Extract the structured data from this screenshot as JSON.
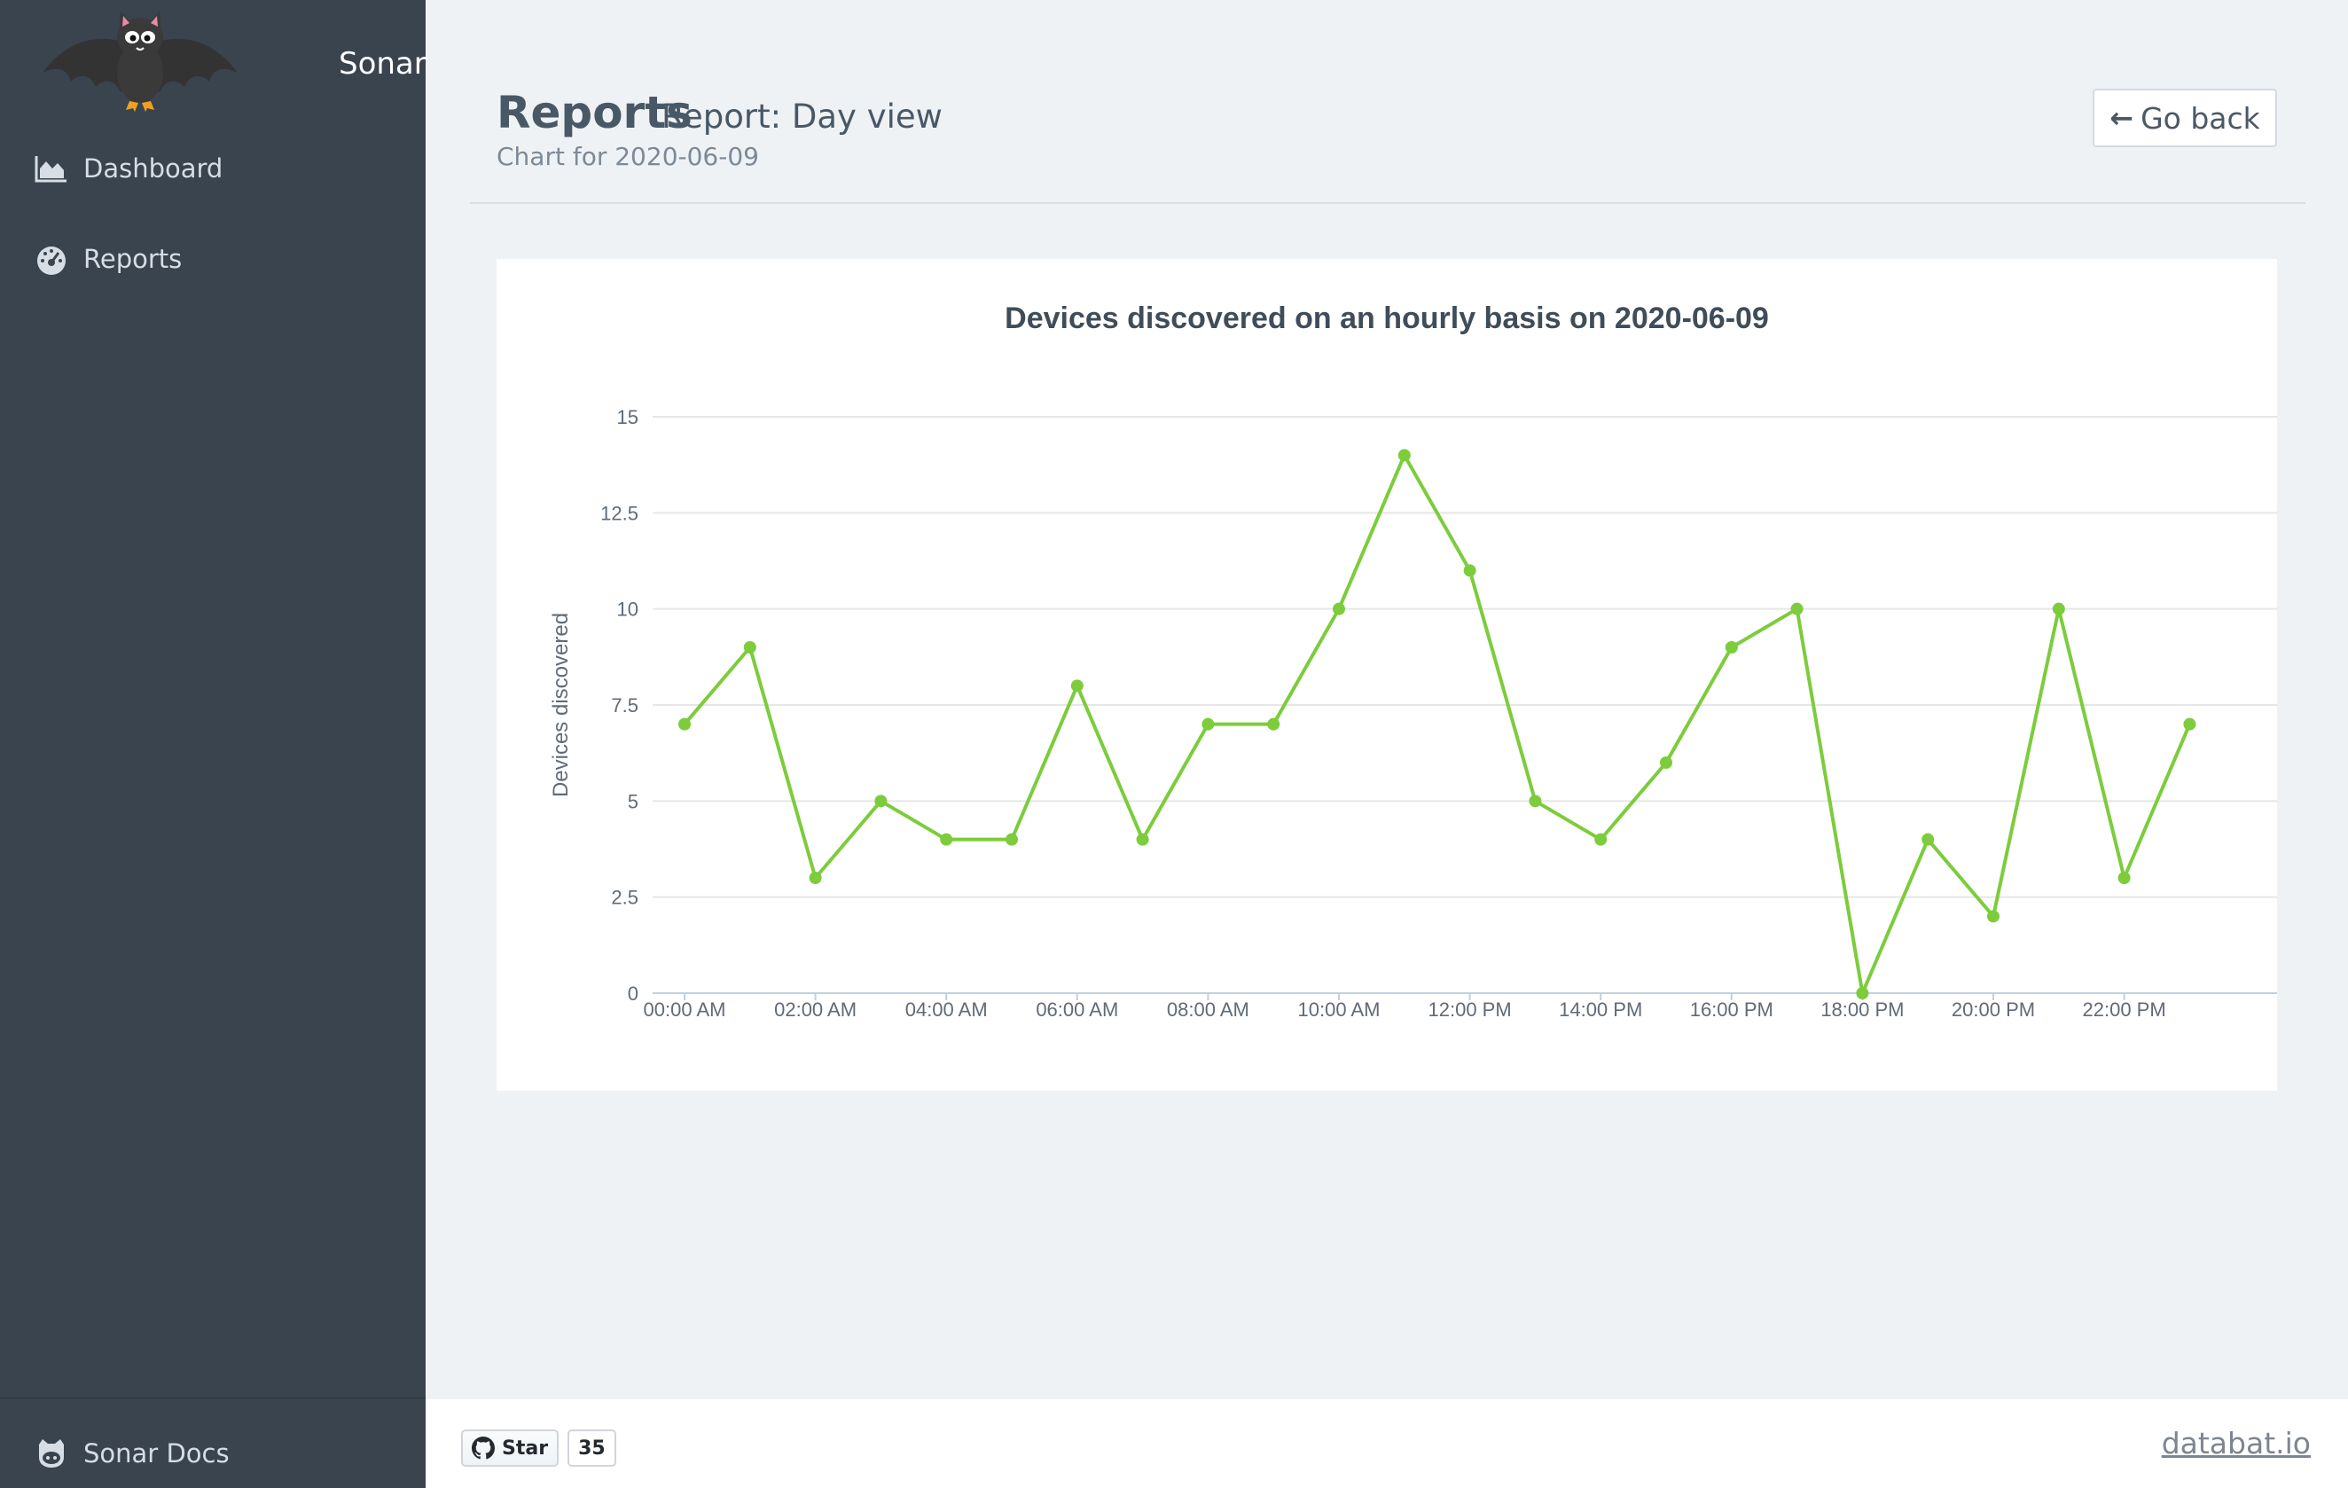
{
  "sidebar": {
    "brand": "Sonar",
    "items": [
      {
        "label": "Dashboard",
        "icon": "area-chart-icon"
      },
      {
        "label": "Reports",
        "icon": "tachometer-icon"
      }
    ],
    "footer_item": {
      "label": "Sonar Docs",
      "icon": "github-icon"
    }
  },
  "header": {
    "title": "Reports",
    "subtitle_inline": "Report: Day view",
    "subtitle": "Chart for 2020-06-09",
    "back_label": "Go back"
  },
  "footer": {
    "star_label": "Star",
    "star_count": "35",
    "site_link": "databat.io"
  },
  "colors": {
    "sidebar": "#39444f",
    "line": "#7ccc3c",
    "background": "#eff2f5"
  },
  "chart_data": {
    "type": "line",
    "title": "Devices discovered on an hourly basis on 2020-06-09",
    "ylabel": "Devices discovered",
    "xlabel": "",
    "ylim": [
      0,
      15
    ],
    "yticks": [
      "0",
      "2.5",
      "5",
      "7.5",
      "10",
      "12.5",
      "15"
    ],
    "x": [
      "00:00 AM",
      "01:00 AM",
      "02:00 AM",
      "03:00 AM",
      "04:00 AM",
      "05:00 AM",
      "06:00 AM",
      "07:00 AM",
      "08:00 AM",
      "09:00 AM",
      "10:00 AM",
      "11:00 AM",
      "12:00 PM",
      "13:00 PM",
      "14:00 PM",
      "15:00 PM",
      "16:00 PM",
      "17:00 PM",
      "18:00 PM",
      "19:00 PM",
      "20:00 PM",
      "21:00 PM",
      "22:00 PM",
      "23:00 PM"
    ],
    "xtick_labels": [
      "00:00 AM",
      "02:00 AM",
      "04:00 AM",
      "06:00 AM",
      "08:00 AM",
      "10:00 AM",
      "12:00 PM",
      "14:00 PM",
      "16:00 PM",
      "18:00 PM",
      "20:00 PM",
      "22:00 PM"
    ],
    "values": [
      7,
      9,
      3,
      5,
      4,
      4,
      8,
      4,
      7,
      7,
      10,
      14,
      11,
      5,
      4,
      6,
      9,
      10,
      0,
      4,
      2,
      10,
      3,
      7
    ],
    "grid": true,
    "legend": "none"
  }
}
